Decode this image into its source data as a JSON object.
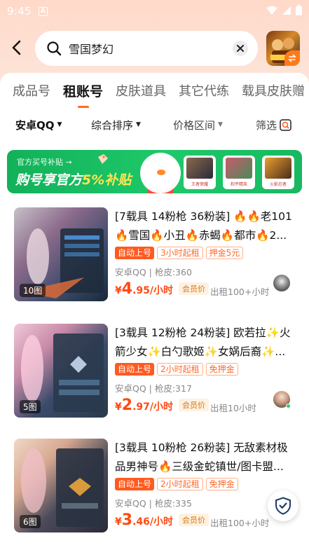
{
  "status_bar": {
    "time": "9:45"
  },
  "search": {
    "query": "雪国梦幻"
  },
  "tabs": [
    {
      "label": "成品号",
      "active": false
    },
    {
      "label": "租账号",
      "active": true
    },
    {
      "label": "皮肤道具",
      "active": false
    },
    {
      "label": "其它代练",
      "active": false
    },
    {
      "label": "载具皮肤赠",
      "active": false
    }
  ],
  "filters": {
    "platform": "安卓QQ",
    "sort": "综合排序",
    "price": "价格区间",
    "filter": "筛选"
  },
  "banner": {
    "subtitle": "官方买号补贴 →",
    "headline_a": "购号享官方",
    "headline_b": "5%补贴",
    "cards": [
      "王者荣耀",
      "和平精英",
      "火影忍者"
    ]
  },
  "listings": [
    {
      "title": "[7载具 14粉枪 36粉装] 🔥🔥老101🔥雪国🔥小丑🔥赤蝎🔥都市🔥2...",
      "tags": [
        "自动上号",
        "3小时起租",
        "押金5元"
      ],
      "meta": "安卓QQ | 枪皮:360",
      "price_int": "4",
      "price_dec": ".95/小时",
      "member": "会员价",
      "rent_count": "出租100+小时",
      "img_count": "10图"
    },
    {
      "title": "[3载具 12粉枪 24粉装] 欧若拉✨火箭少女✨白勺歌姬✨女娲后裔✨...",
      "tags": [
        "自动上号",
        "2小时起租",
        "免押金"
      ],
      "meta": "安卓QQ | 枪皮:317",
      "price_int": "2",
      "price_dec": ".97/小时",
      "member": "会员价",
      "rent_count": "出租10小时",
      "img_count": "5图"
    },
    {
      "title": "[3载具 10粉枪 26粉装] 无敌素材极品男神号🔥三级金蛇镇世/图卡盟...",
      "tags": [
        "自动上号",
        "2小时起租",
        "免押金"
      ],
      "meta": "安卓QQ | 枪皮:335",
      "price_int": "3",
      "price_dec": ".46/小时",
      "member": "会员价",
      "rent_count": "出租100+小时",
      "img_count": "6图"
    }
  ],
  "price_prefix": "¥",
  "colors": {
    "accent": "#ff5a1f",
    "banner_green": "#18b860"
  }
}
